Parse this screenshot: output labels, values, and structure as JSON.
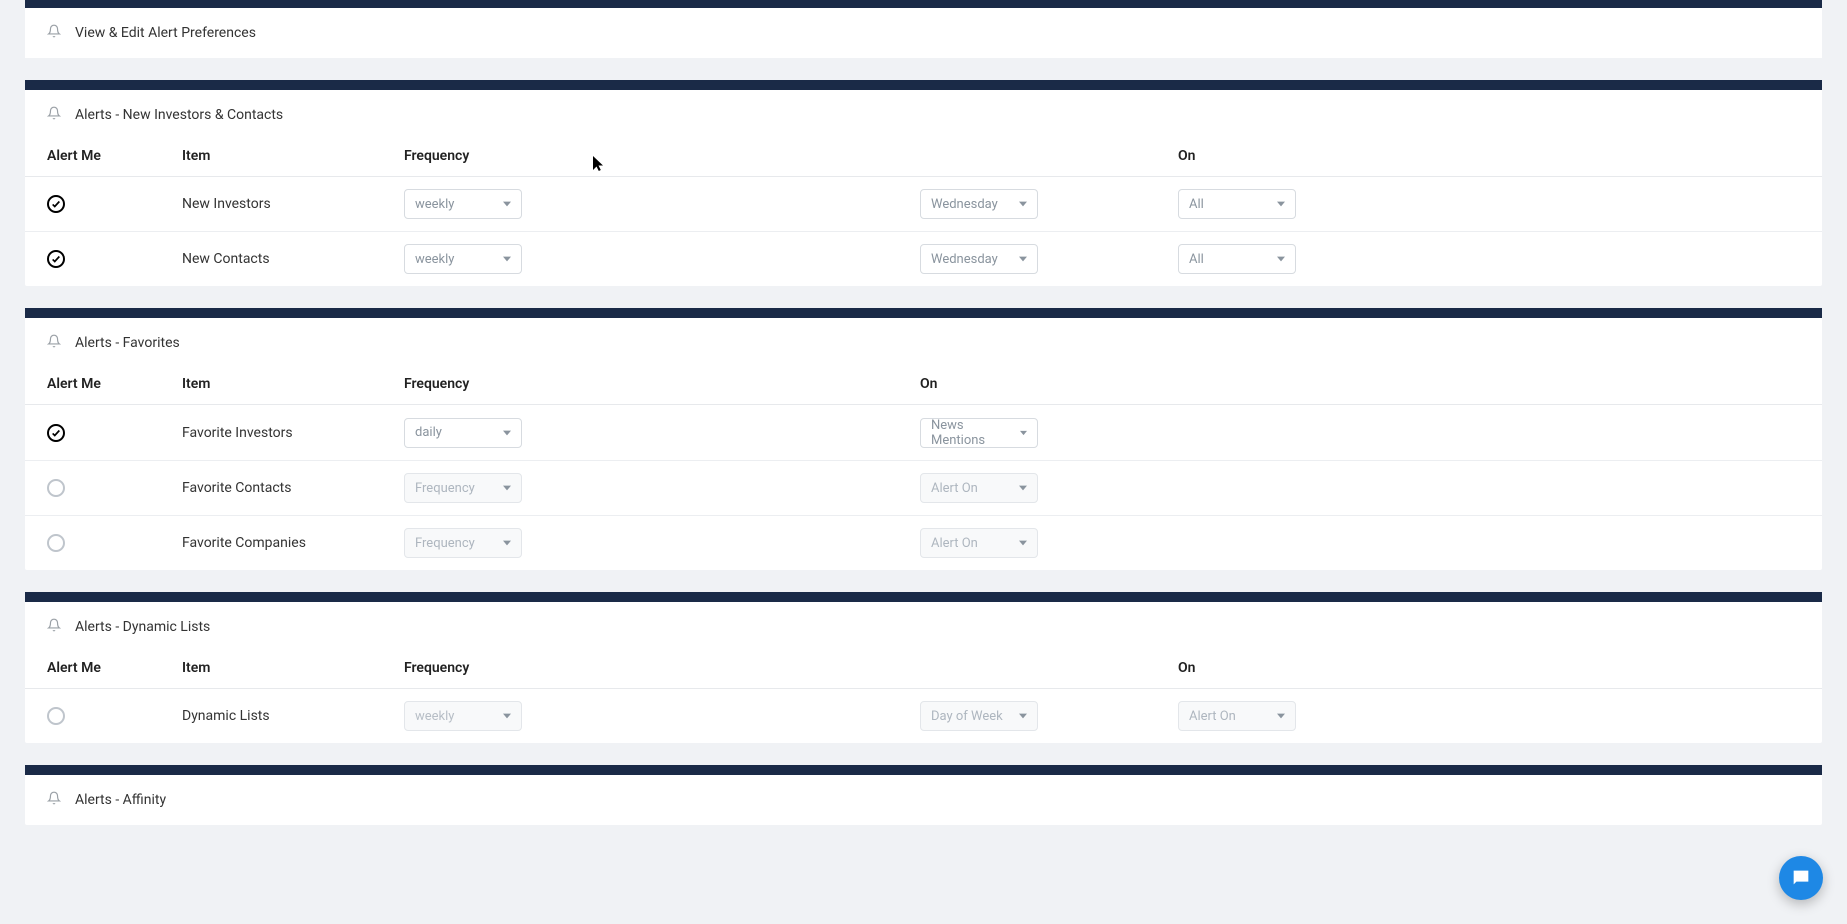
{
  "page": {
    "title": "View & Edit Alert Preferences"
  },
  "columns": {
    "alert_me": "Alert Me",
    "item": "Item",
    "frequency": "Frequency",
    "on": "On"
  },
  "sections": [
    {
      "title": "Alerts - New Investors & Contacts",
      "has_day_column": true,
      "rows": [
        {
          "checked": true,
          "item": "New Investors",
          "freq": "weekly",
          "freq_disabled": false,
          "day": "Wednesday",
          "day_disabled": false,
          "on": "All",
          "on_disabled": false
        },
        {
          "checked": true,
          "item": "New Contacts",
          "freq": "weekly",
          "freq_disabled": false,
          "day": "Wednesday",
          "day_disabled": false,
          "on": "All",
          "on_disabled": false
        }
      ]
    },
    {
      "title": "Alerts - Favorites",
      "has_day_column": false,
      "rows": [
        {
          "checked": true,
          "item": "Favorite Investors",
          "freq": "daily",
          "freq_disabled": false,
          "on": "News Mentions",
          "on_disabled": false
        },
        {
          "checked": false,
          "item": "Favorite Contacts",
          "freq": "Frequency",
          "freq_disabled": true,
          "on": "Alert On",
          "on_disabled": true
        },
        {
          "checked": false,
          "item": "Favorite Companies",
          "freq": "Frequency",
          "freq_disabled": true,
          "on": "Alert On",
          "on_disabled": true
        }
      ]
    },
    {
      "title": "Alerts - Dynamic Lists",
      "has_day_column": true,
      "rows": [
        {
          "checked": false,
          "item": "Dynamic Lists",
          "freq": "weekly",
          "freq_disabled": true,
          "day": "Day of Week",
          "day_disabled": true,
          "on": "Alert On",
          "on_disabled": true
        }
      ]
    },
    {
      "title": "Alerts - Affinity",
      "has_day_column": false,
      "rows": []
    }
  ],
  "chat": {
    "label": "chat"
  }
}
